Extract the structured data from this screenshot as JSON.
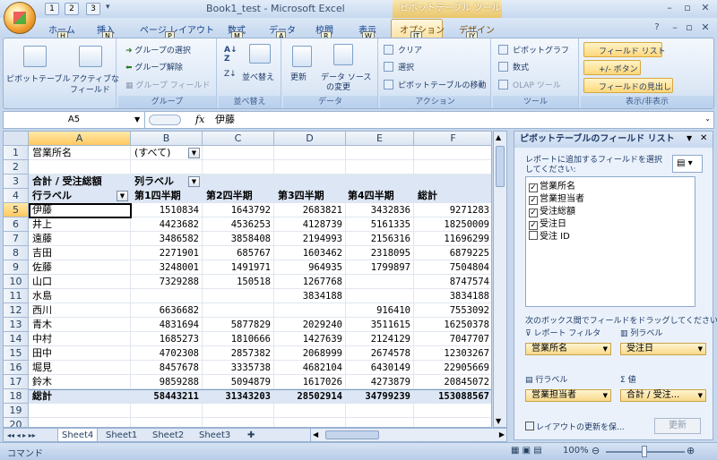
{
  "window": {
    "title": "Book1_test - Microsoft Excel",
    "context_title": "ピボットテーブル ツール",
    "qat": [
      "1",
      "2",
      "3"
    ]
  },
  "tabs": [
    {
      "label": "ホーム",
      "key": "H"
    },
    {
      "label": "挿入",
      "key": "N"
    },
    {
      "label": "ページ レイアウト",
      "key": "P"
    },
    {
      "label": "数式",
      "key": "M"
    },
    {
      "label": "データ",
      "key": "A"
    },
    {
      "label": "校閲",
      "key": "R"
    },
    {
      "label": "表示",
      "key": "W"
    },
    {
      "label": "オプション",
      "key": "JT"
    },
    {
      "label": "デザイン",
      "key": "JY"
    }
  ],
  "ribbon": {
    "pivottable_btn": "ピボットテーブル",
    "active_field_btn": [
      "アクティブな",
      "フィールド"
    ],
    "group": {
      "label": "グループ",
      "select": "グループの選択",
      "ungroup": "グループ解除",
      "field": "グループ フィールド"
    },
    "sort": {
      "label": "並べ替え",
      "btn": "並べ替え"
    },
    "data": {
      "label": "データ",
      "refresh": "更新",
      "change_source": [
        "データ ソース",
        "の変更"
      ]
    },
    "action": {
      "label": "アクション",
      "clear": "クリア",
      "select": "選択",
      "move": "ピボットテーブルの移動"
    },
    "tools": {
      "label": "ツール",
      "chart": "ピボットグラフ",
      "formula": "数式",
      "olap": "OLAP ツール"
    },
    "show": {
      "label": "表示/非表示",
      "fieldlist": "フィールド リスト",
      "buttons": "+/- ボタン",
      "headers": "フィールドの見出し"
    }
  },
  "formula": {
    "namebox": "A5",
    "value": "伊藤"
  },
  "columns": [
    "A",
    "B",
    "C",
    "D",
    "E",
    "F"
  ],
  "rows": [
    "1",
    "2",
    "3",
    "4",
    "5",
    "6",
    "7",
    "8",
    "9",
    "10",
    "11",
    "12",
    "13",
    "14",
    "15",
    "16",
    "17",
    "18",
    "19",
    "20"
  ],
  "sheet": {
    "r1": {
      "a": "営業所名",
      "b": "(すべて)"
    },
    "r3": {
      "a": "合計 / 受注総額",
      "b": "列ラベル"
    },
    "r4": {
      "a": "行ラベル",
      "b": "第1四半期",
      "c": "第2四半期",
      "d": "第3四半期",
      "e": "第4四半期",
      "f": "総計"
    },
    "data": [
      [
        "伊藤",
        "1510834",
        "1643792",
        "2683821",
        "3432836",
        "9271283"
      ],
      [
        "井上",
        "4423682",
        "4536253",
        "4128739",
        "5161335",
        "18250009"
      ],
      [
        "遠藤",
        "3486582",
        "3858408",
        "2194993",
        "2156316",
        "11696299"
      ],
      [
        "吉田",
        "2271901",
        "685767",
        "1603462",
        "2318095",
        "6879225"
      ],
      [
        "佐藤",
        "3248001",
        "1491971",
        "964935",
        "1799897",
        "7504804"
      ],
      [
        "山口",
        "7329288",
        "150518",
        "1267768",
        "",
        "8747574"
      ],
      [
        "水島",
        "",
        "",
        "3834188",
        "",
        "3834188"
      ],
      [
        "西川",
        "6636682",
        "",
        "",
        "916410",
        "7553092"
      ],
      [
        "青木",
        "4831694",
        "5877829",
        "2029240",
        "3511615",
        "16250378"
      ],
      [
        "中村",
        "1685273",
        "1810666",
        "1427639",
        "2124129",
        "7047707"
      ],
      [
        "田中",
        "4702308",
        "2857382",
        "2068999",
        "2674578",
        "12303267"
      ],
      [
        "堀見",
        "8457678",
        "3335738",
        "4682104",
        "6430149",
        "22905669"
      ],
      [
        "鈴木",
        "9859288",
        "5094879",
        "1617026",
        "4273879",
        "20845072"
      ]
    ],
    "total": [
      "総計",
      "58443211",
      "31343203",
      "28502914",
      "34799239",
      "153088567"
    ]
  },
  "sheettabs": [
    "Sheet4",
    "Sheet1",
    "Sheet2",
    "Sheet3"
  ],
  "status": {
    "mode": "コマンド",
    "zoom": "100%"
  },
  "pane": {
    "title": "ピボットテーブルのフィールド リスト",
    "instruction": [
      "レポートに追加するフィールドを選択",
      "してください:"
    ],
    "fields": [
      {
        "name": "営業所名",
        "checked": true
      },
      {
        "name": "営業担当者",
        "checked": true
      },
      {
        "name": "受注総額",
        "checked": true
      },
      {
        "name": "受注日",
        "checked": true
      },
      {
        "name": "受注 ID",
        "checked": false
      }
    ],
    "drag_instruction": "次のボックス間でフィールドをドラッグしてください:",
    "report_filter": "レポート フィルタ",
    "col_labels": "列ラベル",
    "row_labels": "行ラベル",
    "values": "値",
    "filter_item": "営業所名",
    "col_item": "受注日",
    "row_item": "営業担当者",
    "value_item": "合計 / 受注...",
    "defer": "レイアウトの更新を保...",
    "update": "更新"
  }
}
